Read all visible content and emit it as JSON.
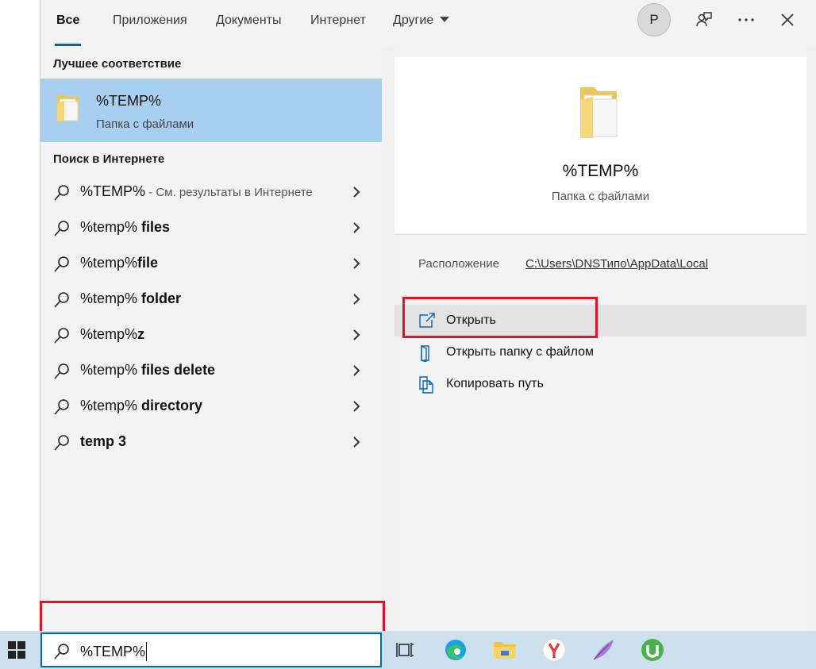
{
  "tabs": [
    {
      "label": "Все",
      "active": true
    },
    {
      "label": "Приложения",
      "active": false
    },
    {
      "label": "Документы",
      "active": false
    },
    {
      "label": "Интернет",
      "active": false
    },
    {
      "label": "Другие",
      "active": false
    }
  ],
  "avatar_letter": "P",
  "best_match": {
    "section_title": "Лучшее соответствие",
    "name": "%TEMP%",
    "type": "Папка с файлами"
  },
  "web_search": {
    "section_title": "Поиск в Интернете",
    "items": [
      {
        "prefix": "%TEMP%",
        "bold": "",
        "hint": " - См. результаты в Интернете"
      },
      {
        "prefix": "%temp% ",
        "bold": "files",
        "hint": ""
      },
      {
        "prefix": "%temp%",
        "bold": "file",
        "hint": ""
      },
      {
        "prefix": "%temp% ",
        "bold": "folder",
        "hint": ""
      },
      {
        "prefix": "%temp%",
        "bold": "z",
        "hint": ""
      },
      {
        "prefix": "%temp% ",
        "bold": "files delete",
        "hint": ""
      },
      {
        "prefix": "%temp% ",
        "bold": "directory",
        "hint": ""
      },
      {
        "prefix": "",
        "bold": "temp 3",
        "hint": ""
      }
    ]
  },
  "detail": {
    "title": "%TEMP%",
    "type": "Папка с файлами",
    "location_label": "Расположение",
    "location_path": "C:\\Users\\DNSТипо\\AppData\\Local",
    "actions": [
      {
        "label": "Открыть",
        "icon": "open-icon"
      },
      {
        "label": "Открыть папку с файлом",
        "icon": "open-folder-location-icon"
      },
      {
        "label": "Копировать путь",
        "icon": "copy-path-icon"
      }
    ]
  },
  "search": {
    "value": "%TEMP%"
  },
  "taskbar_apps": [
    "task-view-icon",
    "edge-icon",
    "file-explorer-icon",
    "yandex-browser-icon",
    "feather-app-icon",
    "utorrent-icon"
  ],
  "colors": {
    "accent": "#0067c0",
    "selection": "#a9cff0",
    "highlight_red": "#e81123",
    "taskbar": "#cde0ee"
  }
}
